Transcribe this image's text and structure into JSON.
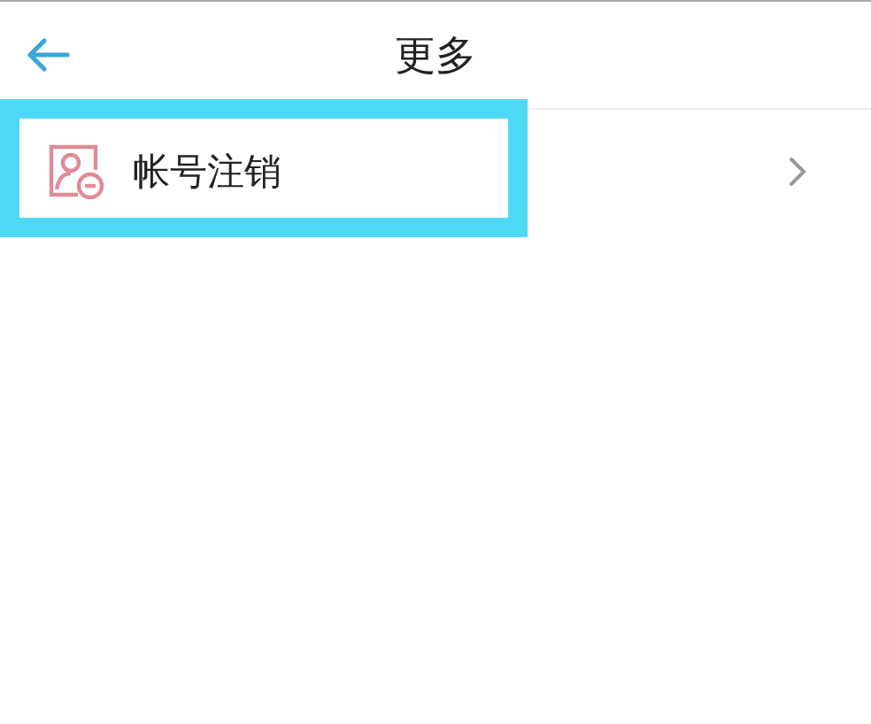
{
  "header": {
    "title": "更多"
  },
  "items": [
    {
      "label": "帐号注销",
      "highlighted": true
    }
  ]
}
